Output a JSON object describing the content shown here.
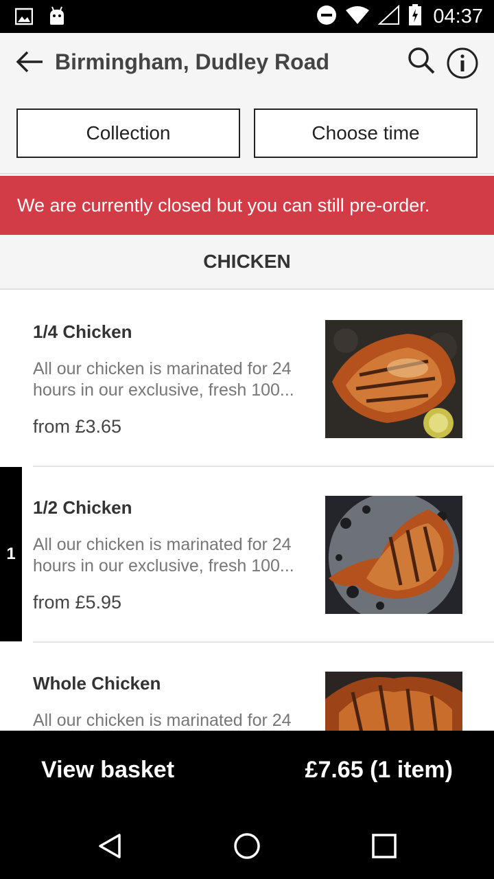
{
  "status_bar": {
    "time": "04:37",
    "icons": [
      "image-icon",
      "android-icon",
      "dnd-icon",
      "wifi-icon",
      "signal-icon",
      "battery-icon"
    ]
  },
  "header": {
    "title": "Birmingham, Dudley Road",
    "back_icon": "arrow-left-icon",
    "search_icon": "search-icon",
    "info_icon": "info-icon"
  },
  "order_mode": {
    "collection_label": "Collection",
    "time_label": "Choose time"
  },
  "notice": {
    "text": "We are currently closed but you can still pre-order.",
    "color": "#d23c47"
  },
  "category": {
    "title": "CHICKEN"
  },
  "menu_items": [
    {
      "name": "1/4 Chicken",
      "description": "All our chicken is marinated for 24 hours in our exclusive, fresh 100...",
      "price": "from £3.65",
      "quantity": ""
    },
    {
      "name": "1/2 Chicken",
      "description": "All our chicken is marinated for 24 hours in our exclusive, fresh 100...",
      "price": "from £5.95",
      "quantity": "1"
    },
    {
      "name": "Whole Chicken",
      "description": "All our chicken is marinated for 24",
      "price": "",
      "quantity": ""
    }
  ],
  "basket": {
    "label": "View basket",
    "total": "£7.65 (1 item)"
  },
  "nav_bar": {
    "icons": [
      "nav-back-icon",
      "nav-home-icon",
      "nav-recents-icon"
    ]
  }
}
